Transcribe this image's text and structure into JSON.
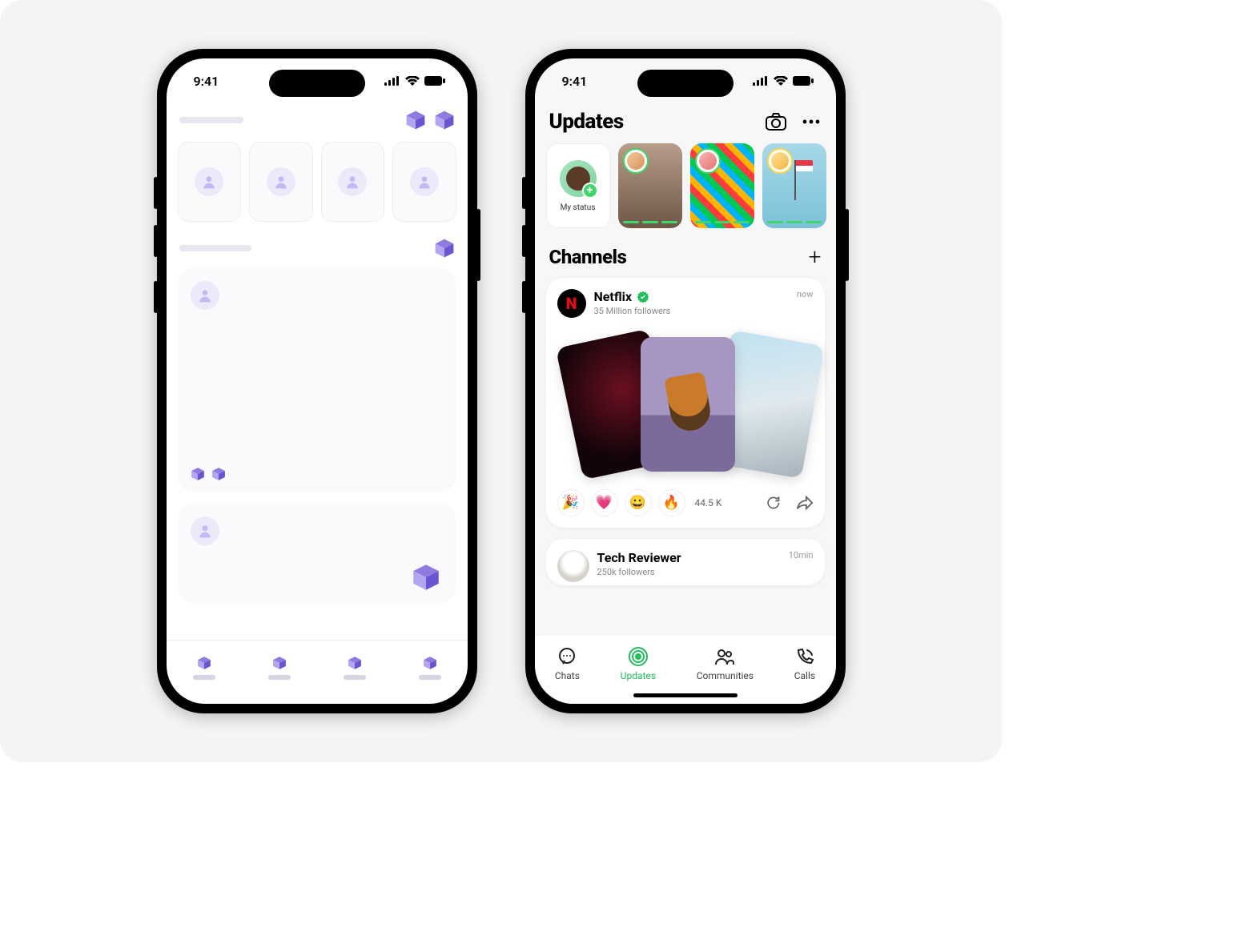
{
  "status": {
    "time": "9:41"
  },
  "phone2": {
    "header": {
      "title": "Updates"
    },
    "myStatusLabel": "My status",
    "channels": {
      "title": "Channels"
    },
    "netflix": {
      "name": "Netflix",
      "avatarLetter": "N",
      "followers": "35 Million followers",
      "time": "now",
      "reactionCount": "44.5 K",
      "emojis": {
        "e1": "🎉",
        "e2": "💗",
        "e3": "😀",
        "e4": "🔥"
      }
    },
    "tech": {
      "name": "Tech Reviewer",
      "followers": "250k followers",
      "time": "10min"
    },
    "tabs": {
      "chats": "Chats",
      "updates": "Updates",
      "communities": "Communities",
      "calls": "Calls"
    }
  }
}
